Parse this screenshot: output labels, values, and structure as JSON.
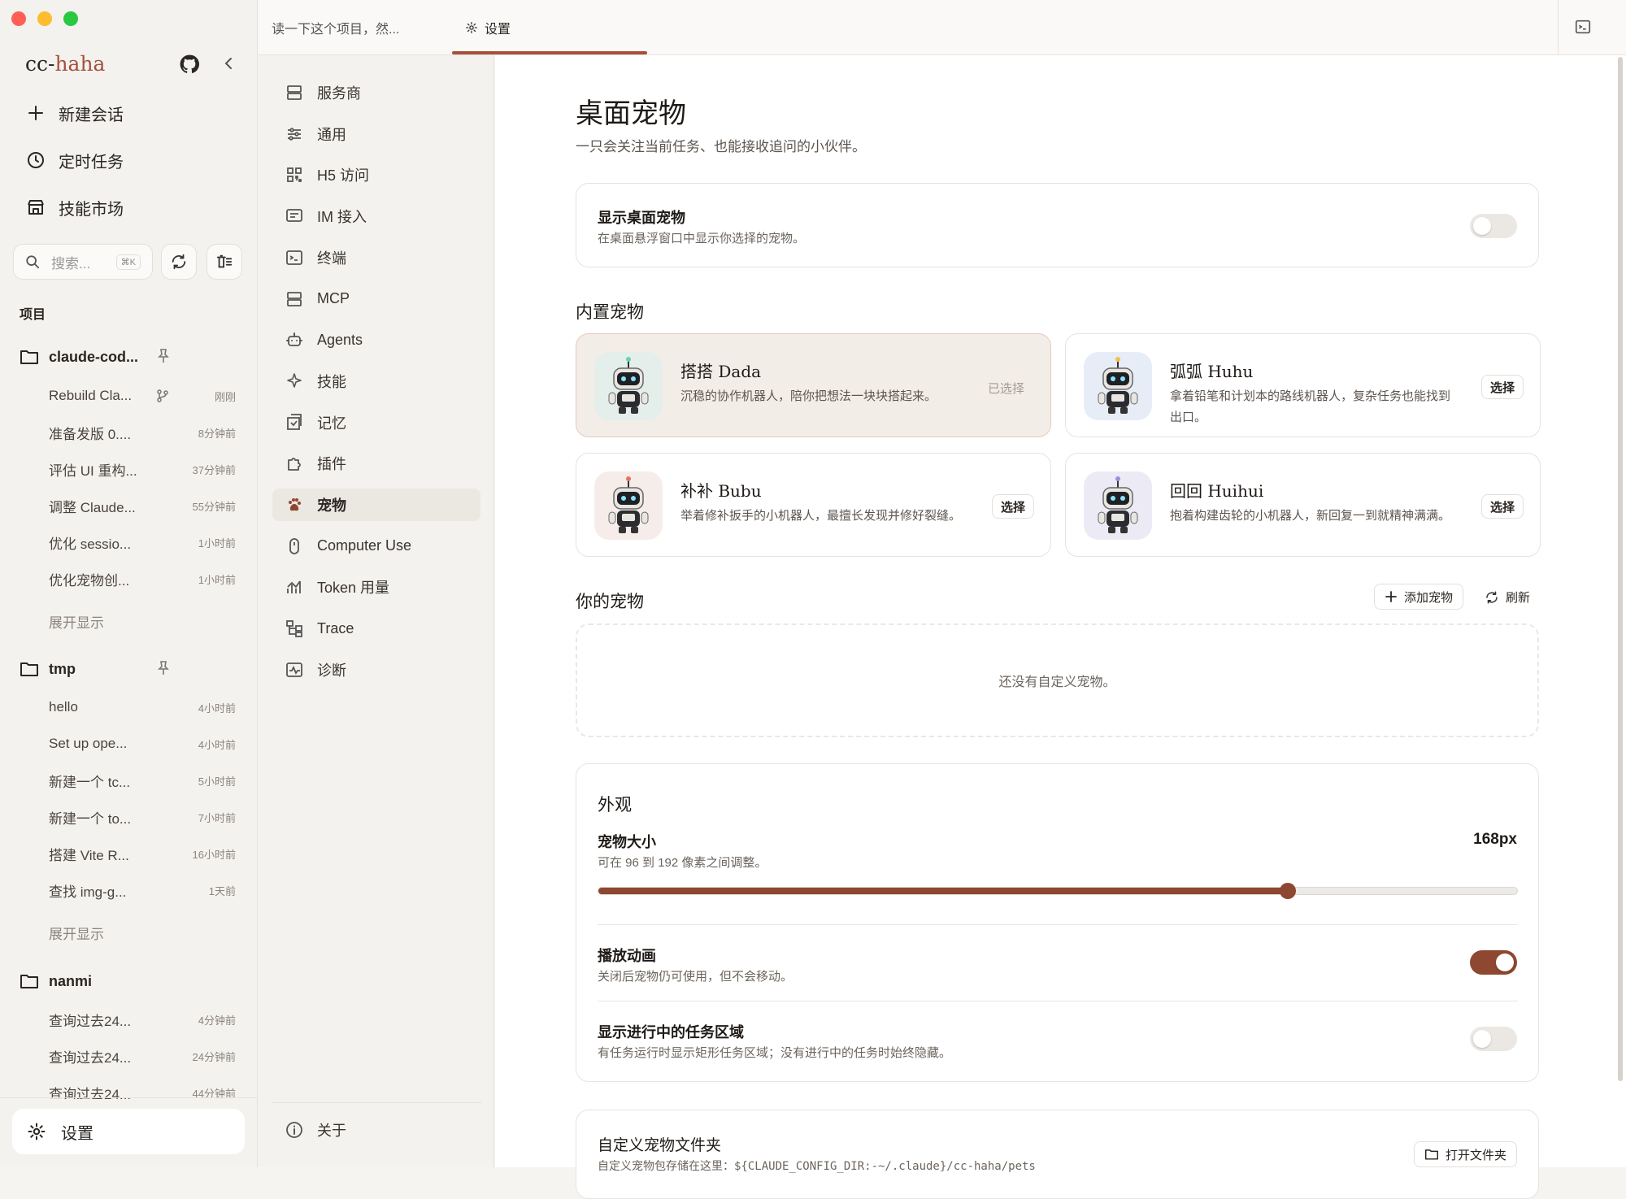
{
  "app": {
    "brand_a": "cc-",
    "brand_b": "haha"
  },
  "sidebar": {
    "nav": [
      {
        "label": "新建会话",
        "icon": "plus-icon"
      },
      {
        "label": "定时任务",
        "icon": "clock-icon"
      },
      {
        "label": "技能市场",
        "icon": "store-icon"
      }
    ],
    "search_placeholder": "搜索...",
    "search_shortcut": "⌘K",
    "projects_title": "项目",
    "projects": [
      {
        "name": "claude-cod...",
        "sessions": [
          [
            "Rebuild Cla...",
            "刚刚"
          ],
          [
            "准备发版 0....",
            "8分钟前"
          ],
          [
            "评估 UI 重构...",
            "37分钟前"
          ],
          [
            "调整 Claude...",
            "55分钟前"
          ],
          [
            "优化 sessio...",
            "1小时前"
          ],
          [
            "优化宠物创...",
            "1小时前"
          ]
        ],
        "more": "展开显示"
      },
      {
        "name": "tmp",
        "sessions": [
          [
            "hello",
            "4小时前"
          ],
          [
            "Set up ope...",
            "4小时前"
          ],
          [
            "新建一个 tc...",
            "5小时前"
          ],
          [
            "新建一个 to...",
            "7小时前"
          ],
          [
            "搭建 Vite R...",
            "16小时前"
          ],
          [
            "查找 img-g...",
            "1天前"
          ]
        ],
        "more": "展开显示"
      },
      {
        "name": "nanmi",
        "sessions": [
          [
            "查询过去24...",
            "4分钟前"
          ],
          [
            "查询过去24...",
            "24分钟前"
          ],
          [
            "查询过去24...",
            "44分钟前"
          ]
        ]
      }
    ],
    "settings_label": "设置"
  },
  "tabs": {
    "tab1": "读一下这个项目，然...",
    "tab2": "设置"
  },
  "settings_nav": {
    "items": [
      {
        "label": "服务商",
        "icon": "server-icon"
      },
      {
        "label": "通用",
        "icon": "sliders-icon"
      },
      {
        "label": "H5 访问",
        "icon": "qr-icon"
      },
      {
        "label": "IM 接入",
        "icon": "message-icon"
      },
      {
        "label": "终端",
        "icon": "terminal-icon"
      },
      {
        "label": "MCP",
        "icon": "server-icon"
      },
      {
        "label": "Agents",
        "icon": "bot-icon"
      },
      {
        "label": "技能",
        "icon": "sparkle-icon"
      },
      {
        "label": "记忆",
        "icon": "memory-icon"
      },
      {
        "label": "插件",
        "icon": "puzzle-icon"
      },
      {
        "label": "宠物",
        "icon": "paw-icon"
      },
      {
        "label": "Computer Use",
        "icon": "mouse-icon"
      },
      {
        "label": "Token 用量",
        "icon": "chart-icon"
      },
      {
        "label": "Trace",
        "icon": "trace-icon"
      },
      {
        "label": "诊断",
        "icon": "diagnose-icon"
      }
    ],
    "active": "宠物",
    "about": "关于"
  },
  "page": {
    "title": "桌面宠物",
    "subtitle": "一只会关注当前任务、也能接收追问的小伙伴。",
    "show_pet": {
      "label": "显示桌面宠物",
      "desc": "在桌面悬浮窗口中显示你选择的宠物。",
      "on": false
    },
    "builtin_title": "内置宠物",
    "pets": [
      {
        "name": "搭搭 Dada",
        "desc": "沉稳的协作机器人，陪你把想法一块块搭起来。",
        "action": "已选择",
        "selected": true,
        "bg": "#e4eeea"
      },
      {
        "name": "弧弧 Huhu",
        "desc": "拿着铅笔和计划本的路线机器人，复杂任务也能找到出口。",
        "action": "选择",
        "selected": false,
        "bg": "#e7edf7"
      },
      {
        "name": "补补 Bubu",
        "desc": "举着修补扳手的小机器人，最擅长发现并修好裂缝。",
        "action": "选择",
        "selected": false,
        "bg": "#f6ecea"
      },
      {
        "name": "回回 Huihui",
        "desc": "抱着构建齿轮的小机器人，新回复一到就精神满满。",
        "action": "选择",
        "selected": false,
        "bg": "#eceaf5"
      }
    ],
    "yours_title": "你的宠物",
    "add_btn": "添加宠物",
    "refresh_btn": "刷新",
    "empty": "还没有自定义宠物。",
    "appearance": {
      "title": "外观",
      "size_label": "宠物大小",
      "size_desc": "可在 96 到 192 像素之间调整。",
      "size_value": "168px",
      "size_fraction": 0.75,
      "anim_label": "播放动画",
      "anim_desc": "关闭后宠物仍可使用，但不会移动。",
      "anim_on": true,
      "task_label": "显示进行中的任务区域",
      "task_desc": "有任务运行时显示矩形任务区域；没有进行中的任务时始终隐藏。",
      "task_on": false
    },
    "folder": {
      "title": "自定义宠物文件夹",
      "desc": "自定义宠物包存储在这里：${CLAUDE_CONFIG_DIR:-~/.claude}/cc-haha/pets",
      "btn": "打开文件夹"
    }
  },
  "colors": {
    "accent": "#a5503a",
    "toggle_on": "#8e4730"
  }
}
